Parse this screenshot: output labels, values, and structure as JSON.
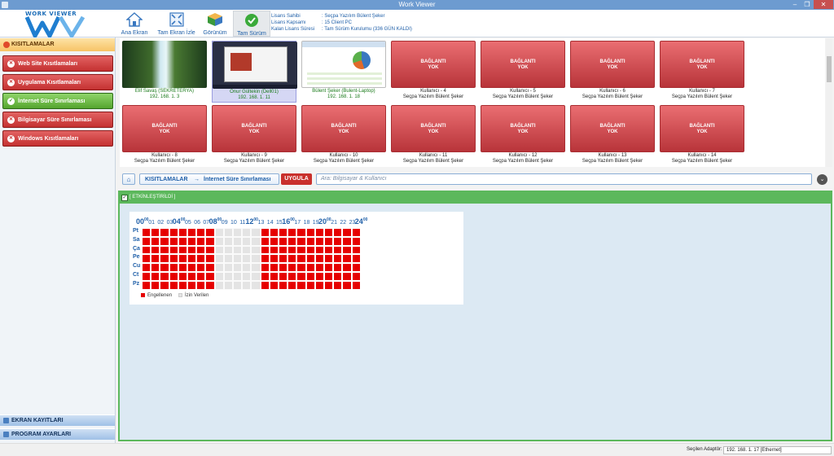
{
  "window": {
    "title": "Work Viewer",
    "min": "‒",
    "max": "❐",
    "close": "✕"
  },
  "logo": {
    "text": "WORK VIEWER"
  },
  "toolbar": {
    "home": "Ana Ekran",
    "fullscreen": "Tam Ekran İzle",
    "view": "Görünüm",
    "full_version": "Tam Sürüm"
  },
  "license": {
    "owner_label": "Lisans Sahibi",
    "owner_value": ":  Seçpa Yazılım Bülent Şeker",
    "scope_label": "Lisans Kapsamı",
    "scope_value": ":  15 Client PC",
    "remaining_label": "Kalan Lisans Süresi",
    "remaining_value": ":  Tam Sürüm Kurulumu (336 GÜN KALDI)"
  },
  "sidebar": {
    "header": "KISITLAMALAR",
    "items": [
      {
        "label": "Web Site Kısıtlamaları"
      },
      {
        "label": "Uygulama Kısıtlamaları"
      },
      {
        "label": "İnternet Süre Sınırlaması"
      },
      {
        "label": "Bilgisayar Süre Sınırlaması"
      },
      {
        "label": "Windows Kısıtlamaları"
      }
    ],
    "footer_screen": "EKRAN KAYITLARI",
    "footer_settings": "PROGRAM AYARLARI"
  },
  "thumbs": [
    {
      "name": "Elif Savaş (SEKRETERYA)",
      "sub": "192. 168. 1. 3",
      "kind": "waterfall"
    },
    {
      "name": "Onur Gültekin (Dell01)",
      "sub": "192. 168. 1. 11",
      "kind": "desktop"
    },
    {
      "name": "Bülent Şeker (Bulent-Laptop)",
      "sub": "192. 168. 1. 18",
      "kind": "sheet"
    },
    {
      "name": "Kullanıcı - 4",
      "sub": "Seçpa Yazılım Bülent Şeker"
    },
    {
      "name": "Kullanıcı - 5",
      "sub": "Seçpa Yazılım Bülent Şeker"
    },
    {
      "name": "Kullanıcı - 6",
      "sub": "Seçpa Yazılım Bülent Şeker"
    },
    {
      "name": "Kullanıcı - 7",
      "sub": "Seçpa Yazılım Bülent Şeker"
    },
    {
      "name": "Kullanıcı - 8",
      "sub": "Seçpa Yazılım Bülent Şeker"
    },
    {
      "name": "Kullanıcı - 9",
      "sub": "Seçpa Yazılım Bülent Şeker"
    },
    {
      "name": "Kullanıcı - 10",
      "sub": "Seçpa Yazılım Bülent Şeker"
    },
    {
      "name": "Kullanıcı - 11",
      "sub": "Seçpa Yazılım Bülent Şeker"
    },
    {
      "name": "Kullanıcı - 12",
      "sub": "Seçpa Yazılım Bülent Şeker"
    },
    {
      "name": "Kullanıcı - 13",
      "sub": "Seçpa Yazılım Bülent Şeker"
    },
    {
      "name": "Kullanıcı - 14",
      "sub": "Seçpa Yazılım Bülent Şeker"
    }
  ],
  "no_connection_line1": "BAĞLANTI",
  "no_connection_line2": "YOK",
  "breadcrumb": {
    "root": "KISITLAMALAR",
    "arrow": "→",
    "current": "İnternet Süre Sınırlaması"
  },
  "apply_button": "UYGULA",
  "search": {
    "placeholder": "Ara: Bilgisayar & Kullanıcı"
  },
  "panel": {
    "enabled_label": "[ ETKİNLEŞTİRİLDİ ]"
  },
  "schedule": {
    "days": [
      "Pt",
      "Sa",
      "Ça",
      "Pe",
      "Cu",
      "Ct",
      "Pz"
    ],
    "hours": [
      "00",
      "01",
      "02",
      "03",
      "04",
      "05",
      "06",
      "07",
      "08",
      "09",
      "10",
      "11",
      "12",
      "13",
      "14",
      "15",
      "16",
      "17",
      "18",
      "19",
      "20",
      "21",
      "22",
      "23",
      "24"
    ],
    "hour_suffix": "00",
    "allowed_hours": [
      8,
      9,
      10,
      11,
      12
    ],
    "legend_blocked": "Engellenen",
    "legend_allowed": "İzin Verilen",
    "colors": {
      "blocked": "#e60000",
      "allowed": "#e4e4e4"
    }
  },
  "status": {
    "adapter_label": "Seçilen Adaptör:",
    "adapter_value": "192. 168. 1. 17  [Ethernet]"
  }
}
